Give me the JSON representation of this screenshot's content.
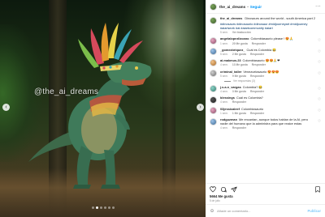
{
  "post": {
    "watermark": "@the_ai_dreams",
    "carousel": {
      "slide_count": 6,
      "active_index": 1
    }
  },
  "header": {
    "username": "the_ai_dreams",
    "separator": "•",
    "follow_label": "Seguir",
    "more_label": "···"
  },
  "caption": {
    "username": "the_ai_dreams",
    "text": "Dinosaurs around the world - south America part 2",
    "hashtags": "#dinosaurs #dinosaurio #dinosaur #midjourneyart #midjourney #aiartwork #ai #aiartcommunity #aiart",
    "time": "5 sem.",
    "translation": "Ver traducción"
  },
  "comments": [
    {
      "avatar": "pink",
      "username": "angelalopezlizcano",
      "text": "Colombiasaurio please ! 😍🙏",
      "time": "1 sem.",
      "likes": "20 Me gusta",
      "reply": "Responder",
      "replies": null
    },
    {
      "avatar": "blue",
      "username": "_gomezbriquez_",
      "text": "Cuál es Colombia 😂",
      "time": "5 sem.",
      "likes": "2 Me gusta",
      "reply": "Responder",
      "replies": null
    },
    {
      "avatar": "orange",
      "username": "ai.makmus.23",
      "text": "Colombiasaurio 😍😍🙏❤",
      "time": "4 sem.",
      "likes": "13 Me gusta",
      "reply": "Responder",
      "replies": null
    },
    {
      "avatar": "gray",
      "username": "criminal_taller",
      "text": "Venezuelasaurio 😍😍😍",
      "time": "5 sem.",
      "likes": "9 Me gusta",
      "reply": "Responder",
      "replies": "Ver respuestas (3)"
    },
    {
      "avatar": "teal",
      "username": "j.s.a.n_vargas",
      "text": "Colombia? 😂",
      "time": "4 sem.",
      "likes": "3 Me gusta",
      "reply": "Responder",
      "replies": null
    },
    {
      "avatar": "dark",
      "username": "blessings",
      "text": "Cuál es Colombia?",
      "time": "4 sem.",
      "likes": "",
      "reply": "Responder",
      "replies": null
    },
    {
      "avatar": "pink",
      "username": "03jessicaleef",
      "text": "Colombiasaurio",
      "time": "1 sem.",
      "likes": "1 Me gusta",
      "reply": "Responder",
      "replies": null
    },
    {
      "avatar": "blue",
      "username": "rodguzman",
      "text": "Me encantan, aunque todos hablan de la AI, pero nadie del humano que la administra para que reaice estas",
      "time": "4 sem.",
      "likes": "",
      "reply": "Responder",
      "replies": null
    }
  ],
  "actions": {
    "likes": "5664 Me gusta",
    "date": "5 de julio"
  },
  "add_comment": {
    "placeholder": "Añade un comentario...",
    "publish_label": "Publicar"
  },
  "colors": {
    "accent": "#0095f6",
    "muted": "#8e8e8e",
    "text": "#262626",
    "like_red": "#ed4956"
  }
}
